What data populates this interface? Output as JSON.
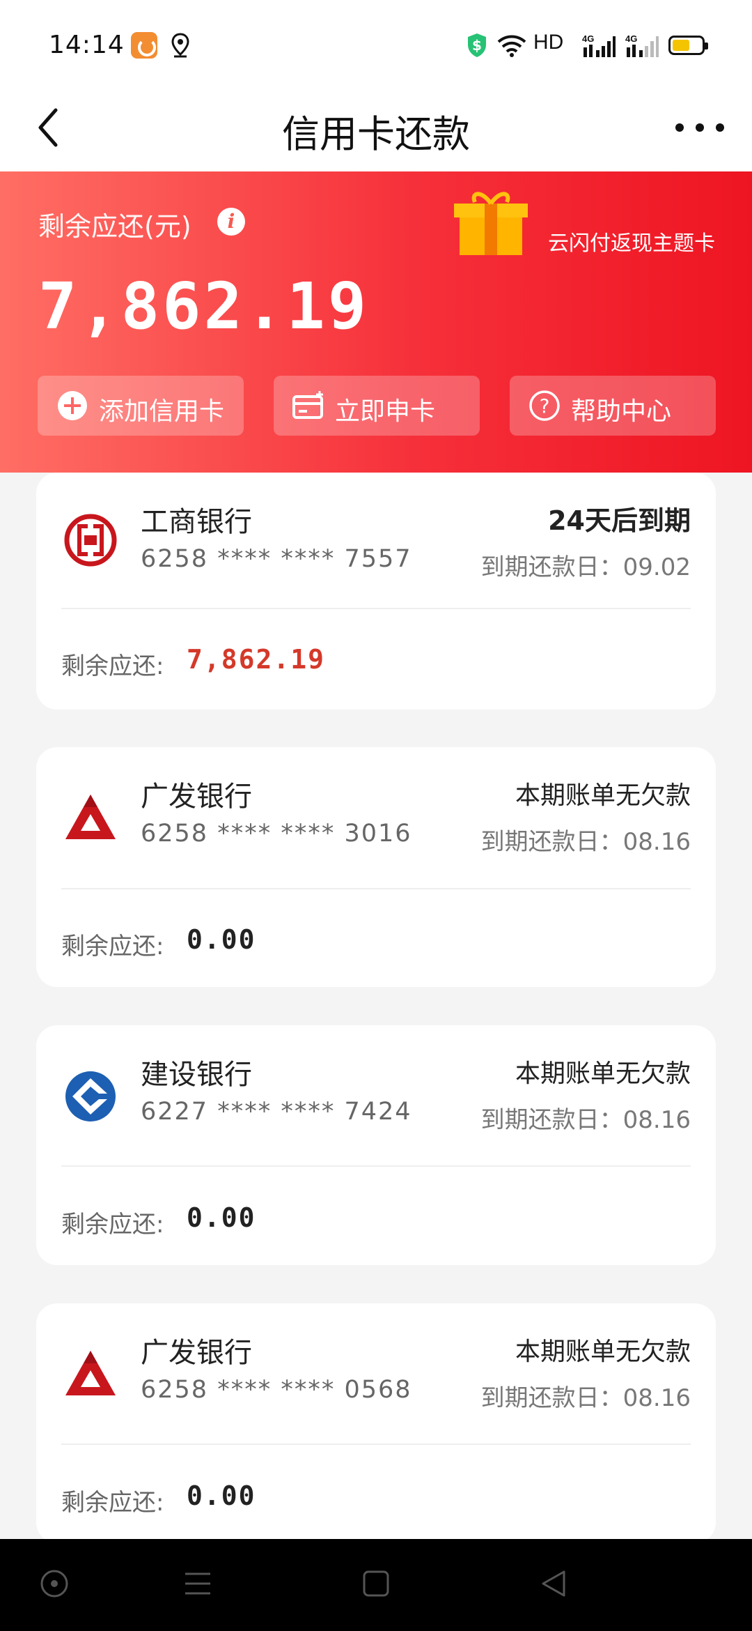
{
  "status_bar": {
    "time": "14:14",
    "network_label": "HD",
    "battery_level_fraction": 0.6,
    "icons": [
      "uc-browser-icon",
      "location-icon",
      "shield-icon",
      "wifi-icon",
      "signal-4g-icon",
      "signal-4g-icon",
      "battery-icon"
    ]
  },
  "nav": {
    "title": "信用卡还款",
    "back_icon": "back-arrow-icon",
    "more_icon": "more-icon"
  },
  "header": {
    "balance_label": "剩余应还(元)",
    "balance_amount": "7,862.19",
    "promo_text": "云闪付返现主题卡",
    "actions": [
      {
        "label": "添加信用卡",
        "icon": "add-circle-icon"
      },
      {
        "label": "立即申卡",
        "icon": "card-icon"
      },
      {
        "label": "帮助中心",
        "icon": "help-icon"
      }
    ],
    "colors": {
      "gradient_start": "#ff6e64",
      "gradient_end": "#ee1522"
    }
  },
  "cards": [
    {
      "bank": "工商银行",
      "number": "6258 **** **** 7557",
      "status": "24天后到期",
      "due": "到期还款日：09.02",
      "remain_label": "剩余应还:",
      "remain": "7,862.19",
      "logo": "icbc-logo"
    },
    {
      "bank": "广发银行",
      "number": "6258 **** **** 3016",
      "status": "本期账单无欠款",
      "due": "到期还款日：08.16",
      "remain_label": "剩余应还:",
      "remain": "0.00",
      "logo": "cgb-logo"
    },
    {
      "bank": "建设银行",
      "number": "6227 **** **** 7424",
      "status": "本期账单无欠款",
      "due": "到期还款日：08.16",
      "remain_label": "剩余应还:",
      "remain": "0.00",
      "logo": "ccb-logo"
    },
    {
      "bank": "广发银行",
      "number": "6258 **** **** 0568",
      "status": "本期账单无欠款",
      "due": "到期还款日：08.16",
      "remain_label": "剩余应还:",
      "remain": "0.00",
      "logo": "cgb-logo"
    }
  ],
  "system_nav": [
    "home-circle-icon",
    "menu-icon",
    "square-icon",
    "back-triangle-icon"
  ]
}
